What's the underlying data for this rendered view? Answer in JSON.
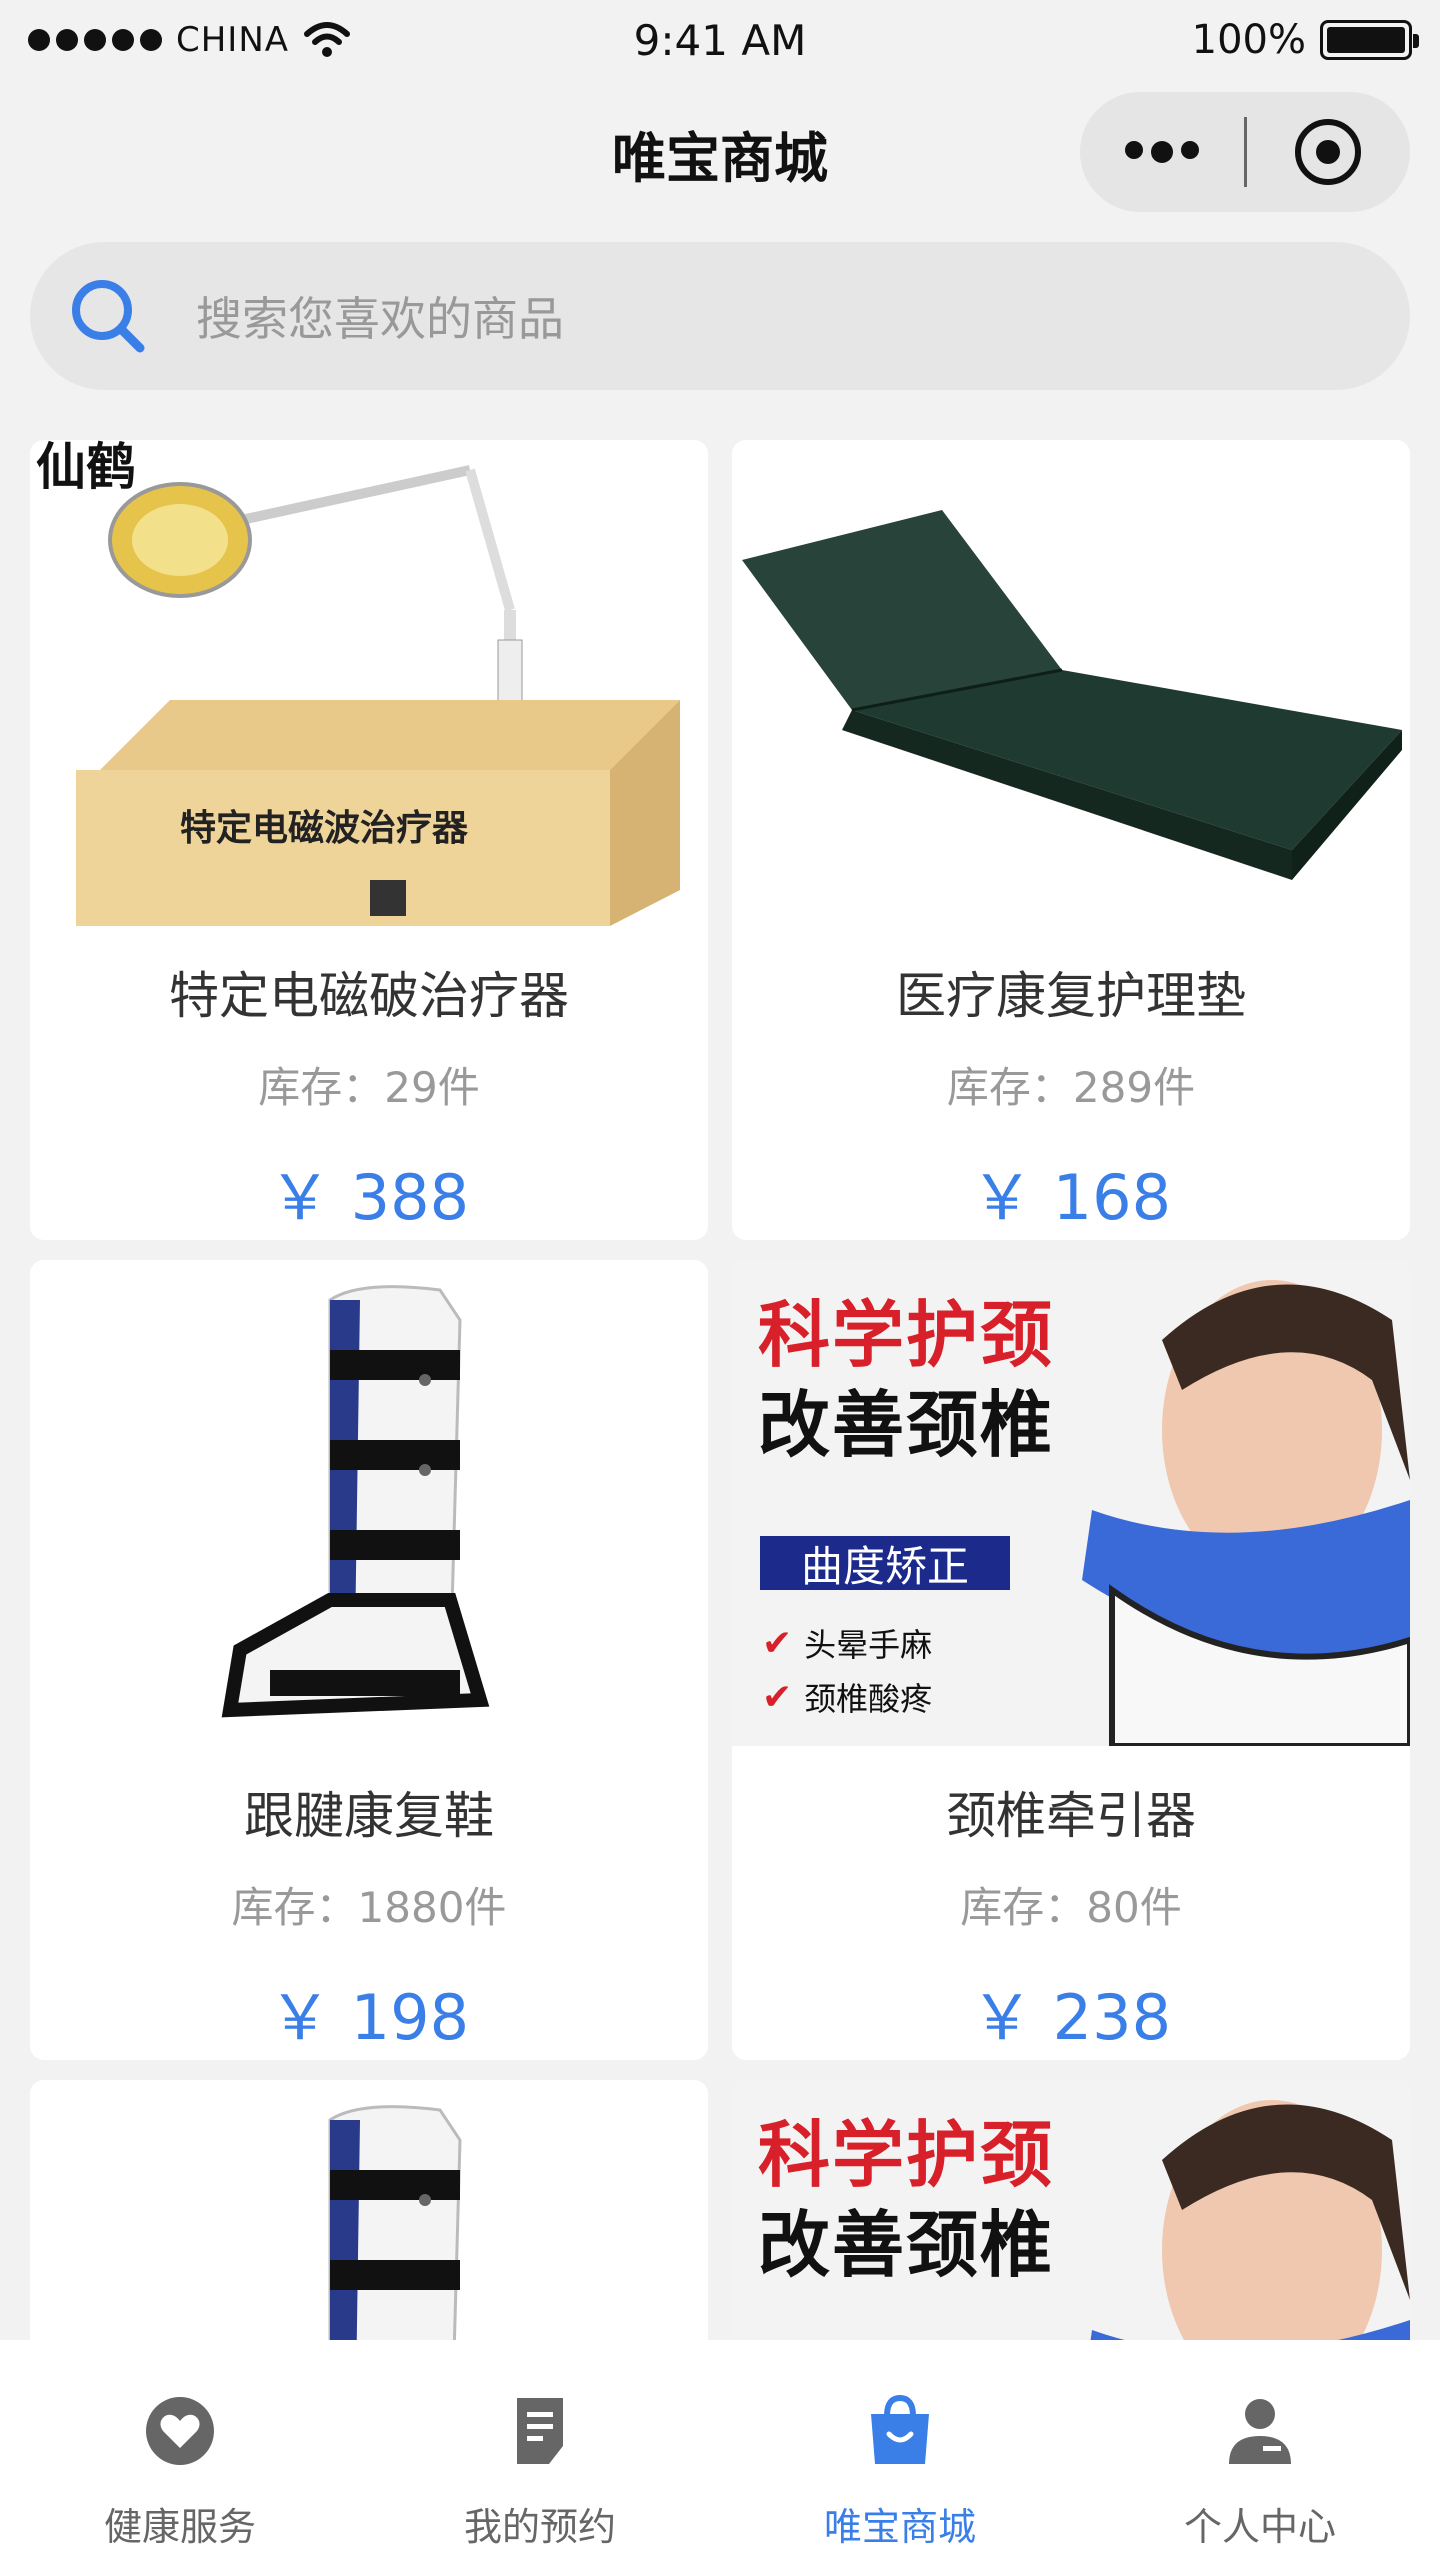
{
  "status_bar": {
    "carrier": "CHINA",
    "time": "9:41 AM",
    "battery": "100%"
  },
  "nav": {
    "title": "唯宝商城"
  },
  "search": {
    "placeholder": "搜索您喜欢的商品"
  },
  "products": [
    {
      "name": "特定电磁破治疗器",
      "stock": "库存：29件",
      "price": "￥ 388",
      "image_text": {
        "brand": "仙鹤",
        "box_label": "特定电磁波治疗器"
      }
    },
    {
      "name": "医疗康复护理垫",
      "stock": "库存：289件",
      "price": "￥ 168"
    },
    {
      "name": "跟腱康复鞋",
      "stock": "库存：1880件",
      "price": "￥ 198"
    },
    {
      "name": "颈椎牵引器",
      "stock": "库存：80件",
      "price": "￥ 238",
      "banner": {
        "line1": "科学护颈",
        "line2": "改善颈椎",
        "tag": "曲度矫正",
        "checks": [
          "头晕手麻",
          "颈椎酸疼"
        ]
      }
    },
    {
      "name": "",
      "stock": "",
      "price": ""
    },
    {
      "name": "",
      "stock": "",
      "price": "",
      "banner": {
        "line1": "科学护颈",
        "line2": "改善颈椎"
      }
    }
  ],
  "tabs": [
    {
      "label": "健康服务",
      "icon": "heart-icon",
      "active": false
    },
    {
      "label": "我的预约",
      "icon": "document-icon",
      "active": false
    },
    {
      "label": "唯宝商城",
      "icon": "shopping-bag-icon",
      "active": true
    },
    {
      "label": "个人中心",
      "icon": "user-icon",
      "active": false
    }
  ],
  "colors": {
    "accent": "#3a7ee8",
    "tab_inactive": "#666666",
    "background": "#f2f2f2"
  }
}
